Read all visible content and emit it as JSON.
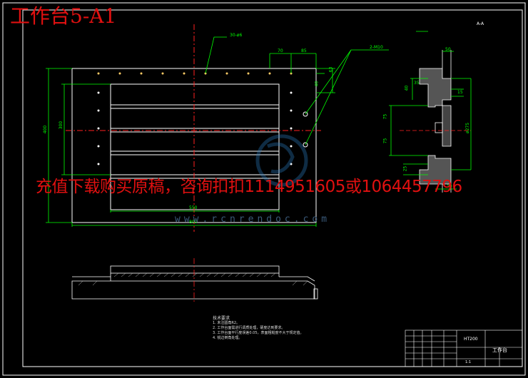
{
  "drawing_title": "工作台5-A1",
  "watermark_text": "充值下载购买原稿，咨询扣扣1114951605或1064457796",
  "watermark_url": "www.rcnrendoc.com",
  "dimensions": {
    "holes": "30-ø6",
    "thread": "2-M10",
    "d70": "70",
    "d85": "85",
    "d63": "63",
    "d40": "40",
    "d400": "400",
    "d300": "300",
    "d550": "550",
    "d800": "800",
    "d50": "50",
    "s40": "40",
    "s35": "35",
    "s15": "15",
    "s75a": "75",
    "s75b": "75",
    "s25": "25",
    "s275": "ø275",
    "s10": "10"
  },
  "section_label": "A-A",
  "notes": {
    "heading": "技术要求",
    "lines": [
      "1. 未注圆角R2。",
      "2. 工作台面需进行调质处理，硬度达到要求。",
      "3. 工作台面平行度误差0.05，表面粗糙度不大于规定值。",
      "4. 锐边倒角处理。"
    ]
  },
  "title_block": {
    "material": "HT200",
    "name": "工作台",
    "scale": "1:1"
  },
  "colors": {
    "line": "#ffffff",
    "dim": "#00ff00",
    "center": "#ff2020",
    "hatch": "#cccccc",
    "title": "#e01010"
  }
}
